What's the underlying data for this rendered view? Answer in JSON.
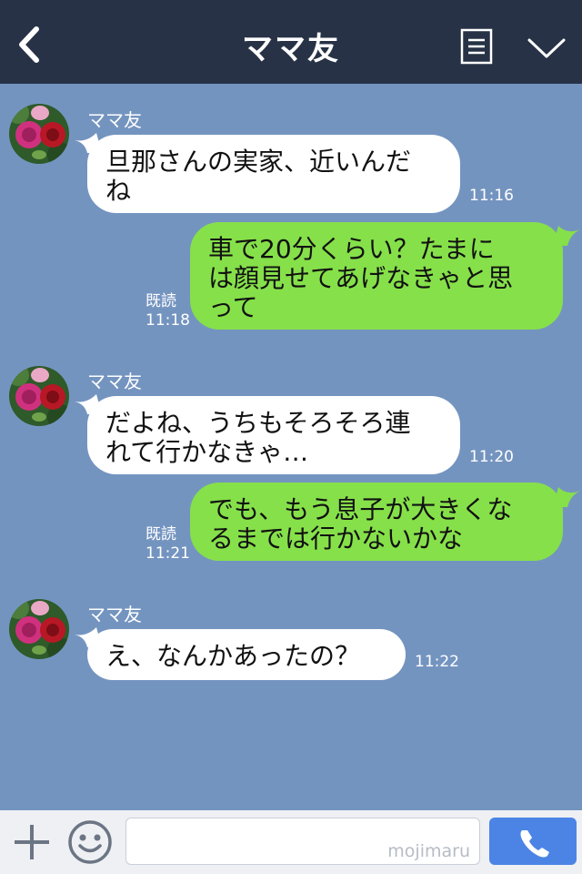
{
  "header": {
    "title": "ママ友",
    "back_icon": "chevron-left-icon",
    "memo_icon": "notes-icon",
    "menu_icon": "chevron-down-icon"
  },
  "messages": [
    {
      "side": "left",
      "sender": "ママ友",
      "text": "旦那さんの実家、近いんだ\nね",
      "time": "11:16"
    },
    {
      "side": "right",
      "read": "既読",
      "text": "車で20分くらい？たまに\nは顔見せてあげなきゃと思\nって",
      "time": "11:18"
    },
    {
      "side": "left",
      "sender": "ママ友",
      "text": "だよね、うちもそろそろ連\nれて行かなきゃ…",
      "time": "11:20"
    },
    {
      "side": "right",
      "read": "既読",
      "text": "でも、もう息子が大きくな\nるまでは行かないかな",
      "time": "11:21"
    },
    {
      "side": "left",
      "sender": "ママ友",
      "text": "え、なんかあったの？",
      "time": "11:22"
    }
  ],
  "footer": {
    "input_value": "",
    "watermark": "mojimaru",
    "plus_icon": "plus-icon",
    "emoji_icon": "smiley-icon",
    "call_icon": "phone-icon"
  },
  "colors": {
    "header_bg": "#273246",
    "chat_bg": "#7494c0",
    "sent_bubble": "#86e04a",
    "received_bubble": "#ffffff",
    "call_button": "#4c84e6"
  }
}
